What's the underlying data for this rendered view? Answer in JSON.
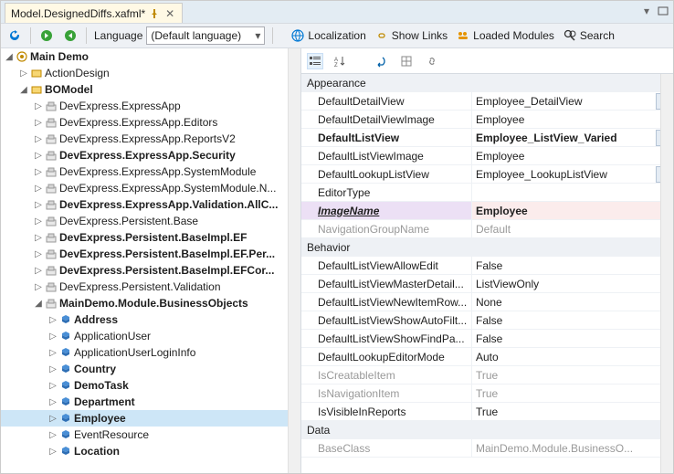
{
  "tab": {
    "title": "Model.DesignedDiffs.xafml*"
  },
  "toolbar": {
    "language_label": "Language",
    "language_value": "(Default language)",
    "localization": "Localization",
    "show_links": "Show Links",
    "loaded_modules": "Loaded Modules",
    "search": "Search"
  },
  "tree": {
    "root": "Main Demo",
    "action_design": "ActionDesign",
    "bomodel": "BOModel",
    "ns": [
      "DevExpress.ExpressApp",
      "DevExpress.ExpressApp.Editors",
      "DevExpress.ExpressApp.ReportsV2",
      "DevExpress.ExpressApp.Security",
      "DevExpress.ExpressApp.SystemModule",
      "DevExpress.ExpressApp.SystemModule.N...",
      "DevExpress.ExpressApp.Validation.AllC...",
      "DevExpress.Persistent.Base",
      "DevExpress.Persistent.BaseImpl.EF",
      "DevExpress.Persistent.BaseImpl.EF.Per...",
      "DevExpress.Persistent.BaseImpl.EFCor...",
      "DevExpress.Persistent.Validation",
      "MainDemo.Module.BusinessObjects"
    ],
    "bo": [
      "Address",
      "ApplicationUser",
      "ApplicationUserLoginInfo",
      "Country",
      "DemoTask",
      "Department",
      "Employee",
      "EventResource",
      "Location"
    ]
  },
  "cats": {
    "appearance": "Appearance",
    "behavior": "Behavior",
    "data": "Data"
  },
  "appearance": {
    "DefaultDetailView": "Employee_DetailView",
    "DefaultDetailViewImage": "Employee",
    "DefaultListView": "Employee_ListView_Varied",
    "DefaultListViewImage": "Employee",
    "DefaultLookupListView": "Employee_LookupListView",
    "EditorType": "",
    "ImageName": "Employee",
    "NavigationGroupName": "Default"
  },
  "behavior": {
    "DefaultListViewAllowEdit": "False",
    "DefaultListViewMasterDetail": "ListViewOnly",
    "DefaultListViewNewItemRow": "None",
    "DefaultListViewShowAutoFilt": "False",
    "DefaultListViewShowFindPa": "False",
    "DefaultLookupEditorMode": "Auto",
    "IsCreatableItem": "True",
    "IsNavigationItem": "True",
    "IsVisibleInReports": "True"
  },
  "labels": {
    "DefaultDetailView": "DefaultDetailView",
    "DefaultDetailViewImage": "DefaultDetailViewImage",
    "DefaultListView": "DefaultListView",
    "DefaultListViewImage": "DefaultListViewImage",
    "DefaultLookupListView": "DefaultLookupListView",
    "EditorType": "EditorType",
    "ImageName": "ImageName",
    "NavigationGroupName": "NavigationGroupName",
    "DefaultListViewAllowEdit": "DefaultListViewAllowEdit",
    "DefaultListViewMasterDetail": "DefaultListViewMasterDetail...",
    "DefaultListViewNewItemRow": "DefaultListViewNewItemRow...",
    "DefaultListViewShowAutoFilt": "DefaultListViewShowAutoFilt...",
    "DefaultListViewShowFindPa": "DefaultListViewShowFindPa...",
    "DefaultLookupEditorMode": "DefaultLookupEditorMode",
    "IsCreatableItem": "IsCreatableItem",
    "IsNavigationItem": "IsNavigationItem",
    "IsVisibleInReports": "IsVisibleInReports",
    "BaseClass": "BaseClass"
  },
  "dataSec": {
    "BaseClass": "MainDemo.Module.BusinessO..."
  }
}
